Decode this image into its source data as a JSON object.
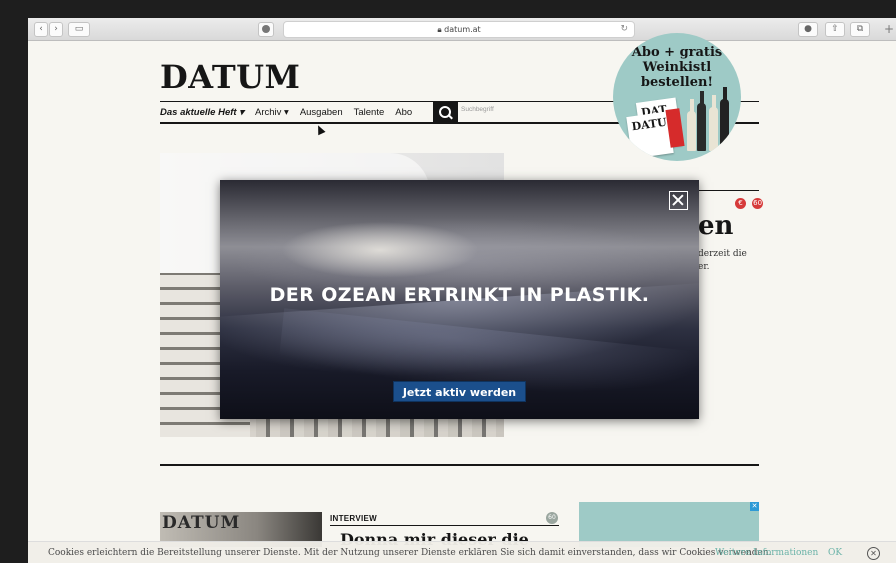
{
  "browser": {
    "url": "datum.at",
    "lock_icon": "lock-icon",
    "toolbar_icons": [
      "back-icon",
      "forward-icon",
      "sidebar-icon",
      "reload-icon",
      "download-icon",
      "share-icon",
      "tabs-icon",
      "new-tab-icon"
    ]
  },
  "site": {
    "logo": "DATUM",
    "nav": {
      "items": [
        "Das aktuelle Heft",
        "Archiv",
        "Ausgaben",
        "Talente",
        "Abo"
      ],
      "dropdown_marker": "▾"
    },
    "search": {
      "placeholder": "Suchbegriff"
    },
    "promo": {
      "line1": "Abo + gratis",
      "line2": "Weinkistl",
      "line3": "bestellen!",
      "mag_label": "DAT",
      "mag_label2": "DATU"
    }
  },
  "article": {
    "badges": [
      "€",
      "60"
    ],
    "title_fragment": "en",
    "text_line1": "derzeit die",
    "text_line2": "er."
  },
  "overlay": {
    "headline": "DER OZEAN ERTRINKT IN PLASTIK.",
    "cta": "Jetzt aktiv werden"
  },
  "teaser": {
    "image_label": "DATUM",
    "kicker": "INTERVIEW",
    "badge": "60",
    "headline_fragment": "Donna mir dieser die"
  },
  "ad": {
    "close_label": "✕"
  },
  "cookie_bar": {
    "message": "Cookies erleichtern die Bereitstellung unserer Dienste. Mit der Nutzung unserer Dienste erklären Sie sich damit einverstanden, dass wir Cookies verwenden.",
    "more_link": "Weitere Informationen",
    "ok": "OK",
    "close": "✕"
  },
  "colors": {
    "accent": "#1b4f8c",
    "promo_bg": "#9ecac6",
    "badge_red": "#d63a3a",
    "link_teal": "#6bb3a8"
  }
}
